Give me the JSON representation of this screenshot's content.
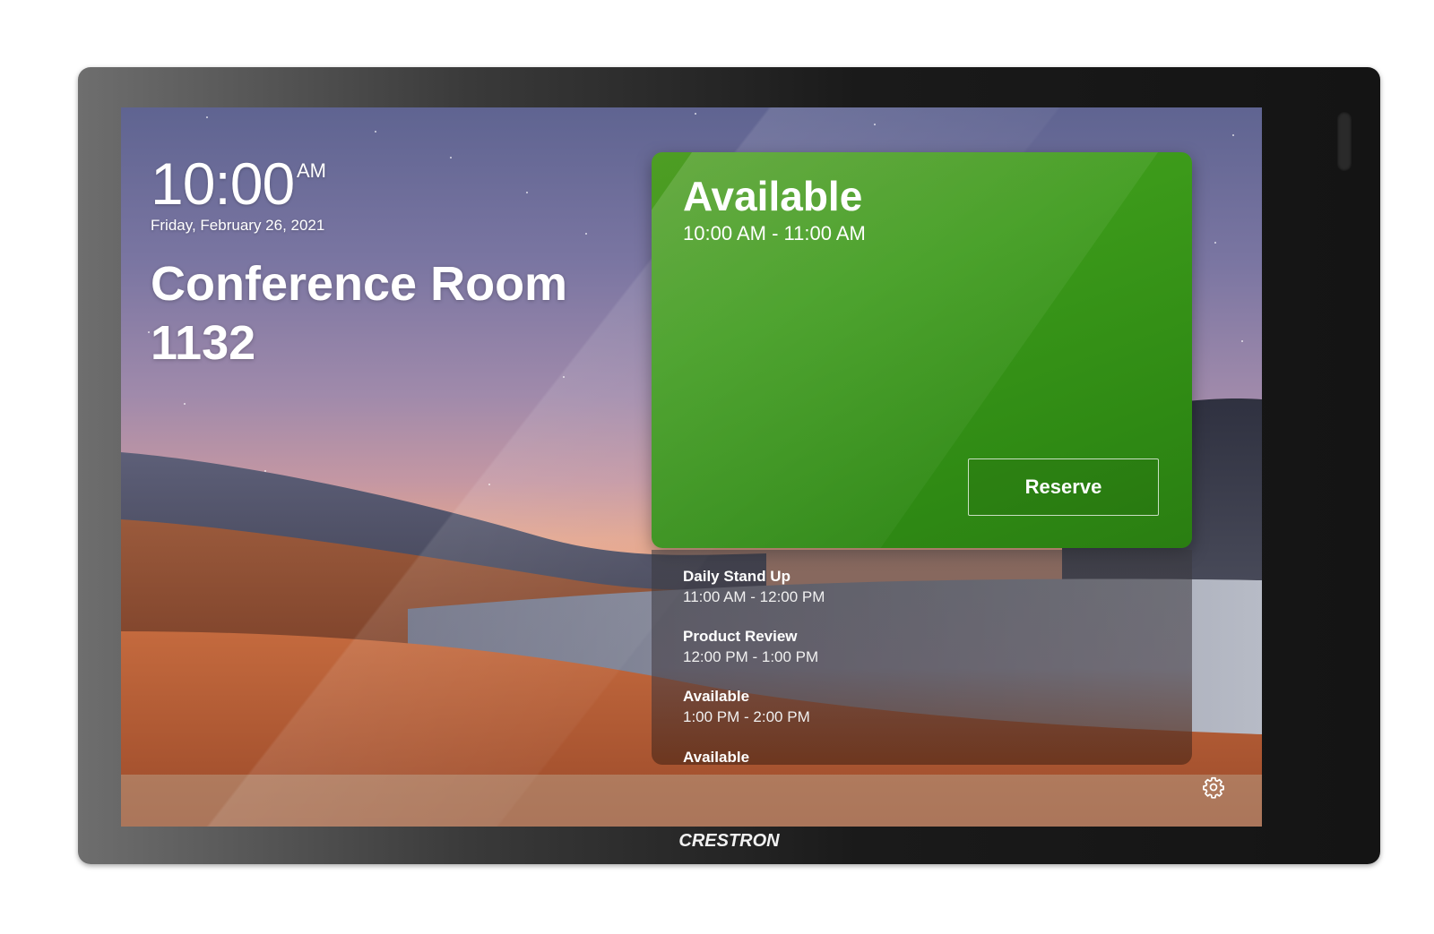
{
  "device": {
    "brand": "CRESTRON"
  },
  "clock": {
    "time": "10:00",
    "ampm": "AM",
    "date": "Friday, February 26, 2021"
  },
  "room": {
    "name": "Conference Room 1132"
  },
  "status": {
    "title": "Available",
    "time_range": "10:00 AM - 11:00 AM",
    "reserve_label": "Reserve",
    "color": "#3c9a1a"
  },
  "schedule": {
    "items": [
      {
        "title": "Daily Stand Up",
        "time": "11:00 AM - 12:00 PM"
      },
      {
        "title": "Product Review",
        "time": "12:00 PM - 1:00 PM"
      },
      {
        "title": "Available",
        "time": "1:00 PM - 2:00 PM"
      },
      {
        "title": "Available",
        "time": ""
      }
    ]
  },
  "icons": {
    "settings": "gear-icon"
  }
}
